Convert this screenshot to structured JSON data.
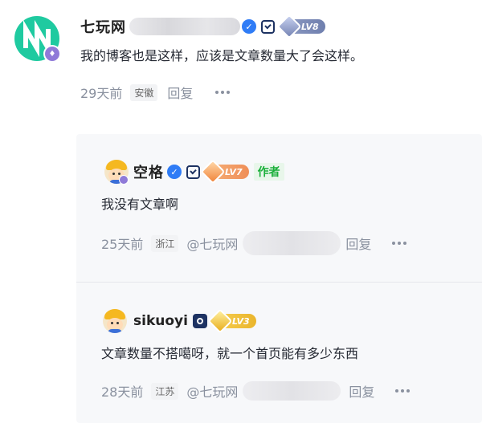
{
  "main_comment": {
    "username": "七玩网",
    "level": "LV8",
    "content": "我的博客也是这样，应该是文章数量大了会这样。",
    "time": "29天前",
    "location": "安徽",
    "reply_label": "回复",
    "colors": {
      "avatar_bg": "#1fcaa0",
      "verify_blue": "#2f7cf6"
    }
  },
  "replies": [
    {
      "username": "空格",
      "level": "LV7",
      "author_tag": "作者",
      "content": "我没有文章啊",
      "time": "25天前",
      "location": "浙江",
      "mention": "@七玩网",
      "reply_label": "回复"
    },
    {
      "username": "sikuoyi",
      "level": "LV3",
      "content": "文章数量不搭噶呀，就一个首页能有多少东西",
      "time": "28天前",
      "location": "江苏",
      "mention": "@七玩网",
      "reply_label": "回复"
    }
  ]
}
